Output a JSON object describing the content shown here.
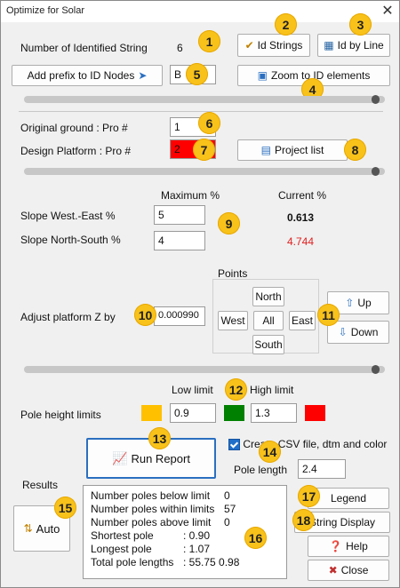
{
  "window": {
    "title": "Optimize for Solar",
    "close": "✕"
  },
  "identified": {
    "label": "Number of Identified   String",
    "value": "6"
  },
  "buttons": {
    "id_strings": "Id Strings",
    "id_by_line": "Id by Line",
    "add_prefix": "Add prefix to ID Nodes",
    "zoom": "Zoom to ID elements",
    "project_list": "Project list",
    "up": "Up",
    "down": "Down",
    "run_report": "Run Report",
    "legend": "Legend",
    "string_display": "String Display",
    "help": "Help",
    "close": "Close",
    "auto": "Auto"
  },
  "prefix": {
    "value": "B"
  },
  "ground": {
    "original_label": "Original ground : Pro #",
    "original_value": "1",
    "design_label": "Design Platform : Pro #",
    "design_value": "2"
  },
  "slope": {
    "col_max": "Maximum    %",
    "col_current": "Current %",
    "west_east_label": "Slope West.-East %",
    "west_east_max": "5",
    "west_east_current": "0.613",
    "north_south_label": "Slope North-South %",
    "north_south_max": "4",
    "north_south_current": "4.744"
  },
  "adjust": {
    "label": "Adjust platform Z by",
    "value": "0.000990",
    "points_title": "Points",
    "north": "North",
    "west": "West",
    "all": "All",
    "east": "East",
    "south": "South"
  },
  "pole": {
    "label": "Pole height limits",
    "low_label": "Low limit",
    "high_label": "High limit",
    "low_value": "0.9",
    "high_value": "1.3",
    "csv_label": "Create CSV file, dtm and color",
    "length_label": "Pole length",
    "length_value": "2.4"
  },
  "results": {
    "title": "Results",
    "below_label": "Number poles below limit",
    "below_value": "0",
    "within_label": "Number poles within limits",
    "within_value": "57",
    "above_label": "Number poles above limit",
    "above_value": "0",
    "shortest_label": "Shortest pole",
    "shortest_value": ": 0.90",
    "longest_label": "Longest pole",
    "longest_value": ": 1.07",
    "total_label": "Total pole lengths",
    "total_value": ": 55.75 0.98"
  },
  "badges": [
    "1",
    "2",
    "3",
    "4",
    "5",
    "6",
    "7",
    "8",
    "9",
    "10",
    "11",
    "12",
    "13",
    "14",
    "15",
    "16",
    "17",
    "18"
  ],
  "colors": {
    "badge": "#f8c21b",
    "low_swatch": "#ffc000",
    "mid_swatch": "#008000",
    "high_swatch": "#ff0000",
    "current_red": "#e02020"
  },
  "icons": [
    "checkmark-icon",
    "id-line-icon",
    "prefix-arrow-icon",
    "zoom-icon",
    "project-list-icon",
    "up-arrow-icon",
    "down-arrow-icon",
    "report-chart-icon",
    "legend-icon",
    "string-display-icon",
    "help-icon",
    "close-circle-icon",
    "sort-arrows-icon"
  ]
}
